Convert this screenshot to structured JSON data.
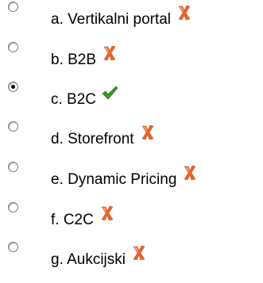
{
  "question": {
    "options": [
      {
        "label": "a. Vertikalni portal",
        "selected": false,
        "mark": "wrong-icon"
      },
      {
        "label": "b. B2B",
        "selected": false,
        "mark": "wrong-icon"
      },
      {
        "label": "c. B2C",
        "selected": true,
        "mark": "correct-icon"
      },
      {
        "label": "d. Storefront",
        "selected": false,
        "mark": "wrong-icon"
      },
      {
        "label": "e. Dynamic Pricing",
        "selected": false,
        "mark": "wrong-icon"
      },
      {
        "label": "f. C2C",
        "selected": false,
        "mark": "wrong-icon"
      },
      {
        "label": "g. Aukcijski",
        "selected": false,
        "mark": "wrong-icon"
      }
    ]
  },
  "colors": {
    "wrong": "#e8652a",
    "correct": "#2f9e1f"
  }
}
